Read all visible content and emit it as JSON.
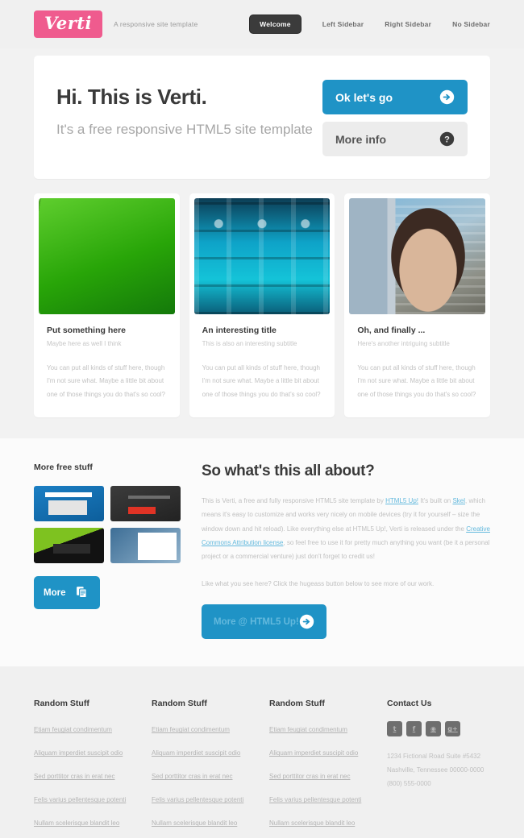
{
  "header": {
    "logo": "Verti",
    "tagline": "A responsive site template",
    "nav": [
      {
        "label": "Welcome",
        "active": true
      },
      {
        "label": "Left Sidebar",
        "active": false
      },
      {
        "label": "Right Sidebar",
        "active": false
      },
      {
        "label": "No Sidebar",
        "active": false
      }
    ]
  },
  "banner": {
    "title": "Hi. This is Verti.",
    "subtitle": "It's a free responsive HTML5 site template",
    "primary_button": {
      "label": "Ok let's go",
      "icon": "arrow-circle-right-icon"
    },
    "secondary_button": {
      "label": "More info",
      "icon": "question-circle-icon"
    }
  },
  "cards": [
    {
      "image": "grass-photo",
      "title": "Put something here",
      "subtitle": "Maybe here as well I think",
      "body": "You can put all kinds of stuff here, though I'm not sure what. Maybe a little bit about one of those things you do that's so cool?"
    },
    {
      "image": "blue-bottles-photo",
      "title": "An interesting title",
      "subtitle": "This is also an interesting subtitle",
      "body": "You can put all kinds of stuff here, though I'm not sure what. Maybe a little bit about one of those things you do that's so cool?"
    },
    {
      "image": "woman-city-photo",
      "title": "Oh, and finally ...",
      "subtitle": "Here's another intriguing subtitle",
      "body": "You can put all kinds of stuff here, though I'm not sure what. Maybe a little bit about one of those things you do that's so cool?"
    }
  ],
  "about": {
    "sidebar": {
      "title": "More free stuff",
      "thumbnails": [
        "blue-tablet-site-thumb",
        "dark-red-button-site-thumb",
        "green-black-device-thumb",
        "blue-white-magazine-thumb"
      ],
      "more_button": {
        "label": "More",
        "icon": "copy-pages-icon"
      }
    },
    "main": {
      "title": "So what's this all about?",
      "paragraph_1_part_1": "This is Verti, a free and fully responsive HTML5 site template by ",
      "link_html5up": "HTML5 Up!",
      "paragraph_1_part_2": " It's built on ",
      "link_skel": "Skel",
      "paragraph_1_part_3": ", which means it's easy to customize and works very nicely on mobile devices (try it for yourself – size the window down and hit reload). Like everything else at HTML5 Up!, Verti is released under the ",
      "link_cc": "Creative Commons Attribution license",
      "paragraph_1_part_4": ", so feel free to use it for pretty much anything you want (be it a personal project or a commercial venture) just don't forget to credit us!",
      "paragraph_2": "Like what you see here? Click the hugeass button below to see more of our work.",
      "cta_button": {
        "label": "More @ HTML5 Up!",
        "icon": "arrow-circle-right-icon"
      }
    }
  },
  "footer": {
    "columns": [
      {
        "title": "Random Stuff",
        "links": [
          "Etiam feugiat condimentum",
          "Aliquam imperdiet suscipit odio",
          "Sed porttitor cras in erat nec",
          "Felis varius pellentesque potenti",
          "Nullam scelerisque blandit leo"
        ]
      },
      {
        "title": "Random Stuff",
        "links": [
          "Etiam feugiat condimentum",
          "Aliquam imperdiet suscipit odio",
          "Sed porttitor cras in erat nec",
          "Felis varius pellentesque potenti",
          "Nullam scelerisque blandit leo"
        ]
      },
      {
        "title": "Random Stuff",
        "links": [
          "Etiam feugiat condimentum",
          "Aliquam imperdiet suscipit odio",
          "Sed porttitor cras in erat nec",
          "Felis varius pellentesque potenti",
          "Nullam scelerisque blandit leo"
        ]
      }
    ],
    "contact": {
      "title": "Contact Us",
      "socials": [
        {
          "name": "twitter-icon",
          "glyph": "t"
        },
        {
          "name": "facebook-icon",
          "glyph": "f"
        },
        {
          "name": "dribbble-icon",
          "glyph": "◉"
        },
        {
          "name": "google-plus-icon",
          "glyph": "g+"
        }
      ],
      "address_line_1": "1234 Fictional Road Suite #5432",
      "address_line_2": "Nashville, Tennessee 00000-0000",
      "phone": "(800) 555-0000"
    }
  },
  "colors": {
    "accent_blue": "#1f93c6",
    "logo_pink": "#ef5b8e",
    "dark": "#3b3b3b",
    "page_bg": "#f2f2f2"
  }
}
